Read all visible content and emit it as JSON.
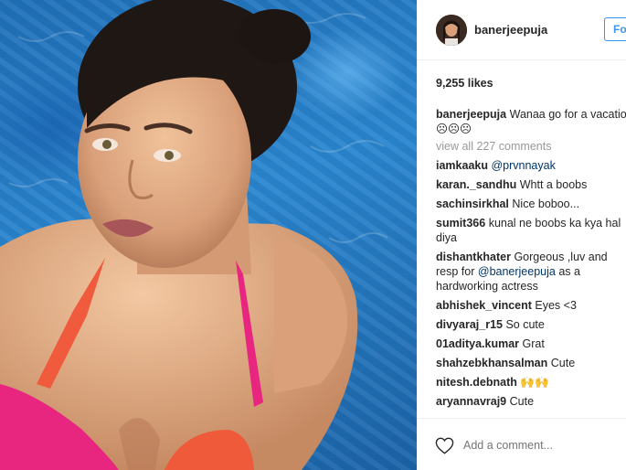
{
  "post": {
    "username": "banerjeepuja",
    "follow_label": "Fo",
    "likes": "9,255 likes",
    "caption": {
      "user": "banerjeepuja",
      "text": "Wanaa go for a vacation again ☹☹☹"
    },
    "view_all": "view all 227 comments",
    "comments": [
      {
        "user": "iamkaaku",
        "text": "",
        "mention": "@prvnnayak",
        "after": ""
      },
      {
        "user": "karan._sandhu",
        "text": "Whtt a boobs",
        "mention": "",
        "after": ""
      },
      {
        "user": "sachinsirkhal",
        "text": "Nice boboo...",
        "mention": "",
        "after": ""
      },
      {
        "user": "sumit366",
        "text": "kunal ne boobs ka kya hal diya",
        "mention": "",
        "after": ""
      },
      {
        "user": "dishantkhater",
        "text": "Gorgeous ,luv and resp for",
        "mention": "@banerjeepuja",
        "after": "as a hardworking actress"
      },
      {
        "user": "abhishek_vincent",
        "text": "Eyes <3",
        "mention": "",
        "after": ""
      },
      {
        "user": "divyaraj_r15",
        "text": "So cute",
        "mention": "",
        "after": ""
      },
      {
        "user": "01aditya.kumar",
        "text": "Grat",
        "mention": "",
        "after": ""
      },
      {
        "user": "shahzebkhansalman",
        "text": "Cute",
        "mention": "",
        "after": ""
      },
      {
        "user": "nitesh.debnath",
        "text": "🙌🙌",
        "mention": "",
        "after": ""
      },
      {
        "user": "aryannavraj9",
        "text": "Cute",
        "mention": "",
        "after": ""
      }
    ],
    "add_comment_placeholder": "Add a comment..."
  },
  "icons": {
    "heart": "heart-icon",
    "avatar": "avatar"
  },
  "colors": {
    "link": "#003569",
    "follow": "#3897f0",
    "muted": "#999999",
    "water": "#2a86cf",
    "swimsuit": "#e8257f"
  }
}
